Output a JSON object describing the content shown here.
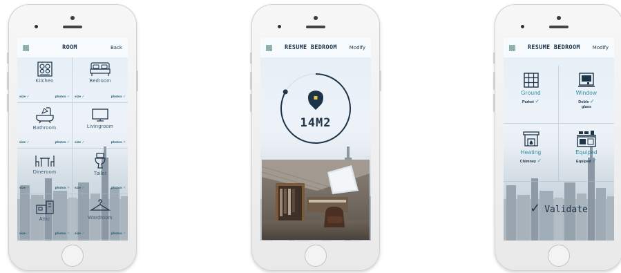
{
  "phone1": {
    "header": {
      "title": "ROOM",
      "back": "Back",
      "menu_icon": "grid-icon"
    },
    "rooms": [
      {
        "label": "Kitchen",
        "icon": "stove-icon",
        "size": "size",
        "size_ok": "✓",
        "photos": "photos",
        "photos_ok": "✓"
      },
      {
        "label": "Bedroom",
        "icon": "bed-icon",
        "size": "size",
        "size_ok": "✓",
        "photos": "photos",
        "photos_ok": "✓"
      },
      {
        "label": "Bathroom",
        "icon": "bathtub-icon",
        "size": "size",
        "size_ok": "✓",
        "photos": "photos",
        "photos_ok": "✓"
      },
      {
        "label": "Livingroom",
        "icon": "tv-icon",
        "size": "size",
        "size_ok": "✓",
        "photos": "photos",
        "photos_ok": "✕"
      },
      {
        "label": "Dineroom",
        "icon": "dining-table-icon",
        "size": "size",
        "size_ok": "✓",
        "photos": "photos",
        "photos_ok": "✕"
      },
      {
        "label": "Toilet",
        "icon": "toilet-icon",
        "size": "size",
        "size_ok": "✓",
        "photos": "photos",
        "photos_ok": "✕"
      },
      {
        "label": "Attic",
        "icon": "attic-icon",
        "size": "size",
        "size_ok": "✓",
        "photos": "photos",
        "photos_ok": "✕"
      },
      {
        "label": "Wardroom",
        "icon": "hanger-icon",
        "size": "size",
        "size_ok": "✓",
        "photos": "photos",
        "photos_ok": "✕"
      }
    ]
  },
  "phone2": {
    "header": {
      "title": "RESUME BEDROOM",
      "modify": "Modify",
      "menu_icon": "grid-icon"
    },
    "area": "14M2",
    "progress_fraction": 0.83,
    "photo": "attic-bedroom-photo"
  },
  "phone3": {
    "header": {
      "title": "RESUME BEDROOM",
      "modify": "Modify",
      "menu_icon": "grid-icon"
    },
    "features": [
      {
        "label": "Ground",
        "icon": "floor-grid-icon",
        "value_line1": "Parket",
        "value_line2": "",
        "check": "✓"
      },
      {
        "label": "Window",
        "icon": "window-icon",
        "value_line1": "Doble",
        "value_line2": "glass",
        "check": "✓"
      },
      {
        "label": "Heating",
        "icon": "fireplace-icon",
        "value_line1": "Chimney",
        "value_line2": "",
        "check": "✓"
      },
      {
        "label": "Equiped",
        "icon": "appliances-icon",
        "value_line1": "Equiped",
        "value_line2": "",
        "check": "✓"
      }
    ],
    "validate": "Validate",
    "validate_check": "✓"
  },
  "colors": {
    "accent": "#2a8a9b",
    "text": "#1d3347",
    "muted": "#3b5a70"
  }
}
